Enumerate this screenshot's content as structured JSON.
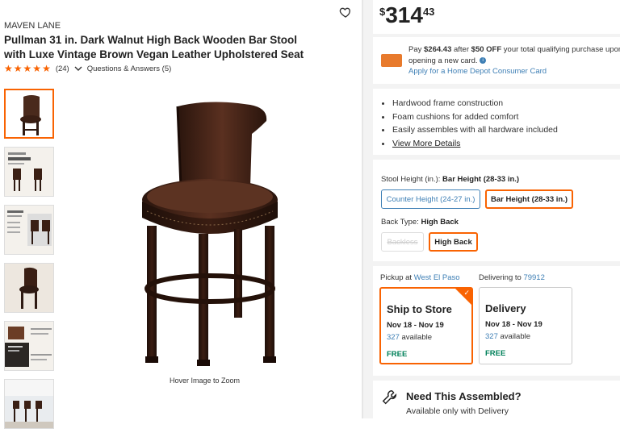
{
  "product": {
    "brand": "MAVEN LANE",
    "title_line1": "Pullman 31 in. Dark Walnut High Back Wooden Bar Stool",
    "title_line2": "with Luxe Vintage Brown Vegan Leather Upholstered Seat",
    "rating_stars": 5,
    "review_count": "(24)",
    "qa_label": "Questions & Answers (5)",
    "hover_label": "Hover Image to Zoom",
    "thumbnails": [
      "thumb-1",
      "thumb-2",
      "thumb-3",
      "thumb-4",
      "thumb-5",
      "thumb-6"
    ]
  },
  "price": {
    "currency": "$",
    "dollars": "314",
    "cents": "43"
  },
  "promo": {
    "text_prefix": "Pay ",
    "pay_amount": "$264.43",
    "text_mid": " after ",
    "discount": "$50 OFF",
    "text_suffix": " your total qualifying purchase upon opening a new card.",
    "link": "Apply for a Home Depot Consumer Card"
  },
  "features": [
    "Hardwood frame construction",
    "Foam cushions for added comfort",
    "Easily assembles with all hardware included",
    "View More Details"
  ],
  "stool_height": {
    "label": "Stool Height (in.):",
    "selected": "Bar Height (28-33 in.)",
    "options": [
      "Counter Height (24-27 in.)",
      "Bar Height (28-33 in.)"
    ]
  },
  "back_type": {
    "label": "Back Type:",
    "selected": "High Back",
    "options": [
      "Backless",
      "High Back"
    ]
  },
  "fulfillment": {
    "pickup_label": "Pickup at",
    "pickup_store": "West El Paso",
    "delivering_label": "Delivering to",
    "zip": "79912",
    "ship": {
      "title": "Ship to Store",
      "dates": "Nov 18 - Nov 19",
      "count": "327",
      "avail": "available",
      "price": "FREE"
    },
    "delivery": {
      "title": "Delivery",
      "dates": "Nov 18 - Nov 19",
      "count": "327",
      "avail": "available",
      "price": "FREE"
    }
  },
  "assembly": {
    "title": "Need This Assembled?",
    "subtitle": "Available only with Delivery"
  },
  "colors": {
    "accent": "#f96302",
    "link": "#3e7fb5",
    "free": "#00805a"
  }
}
